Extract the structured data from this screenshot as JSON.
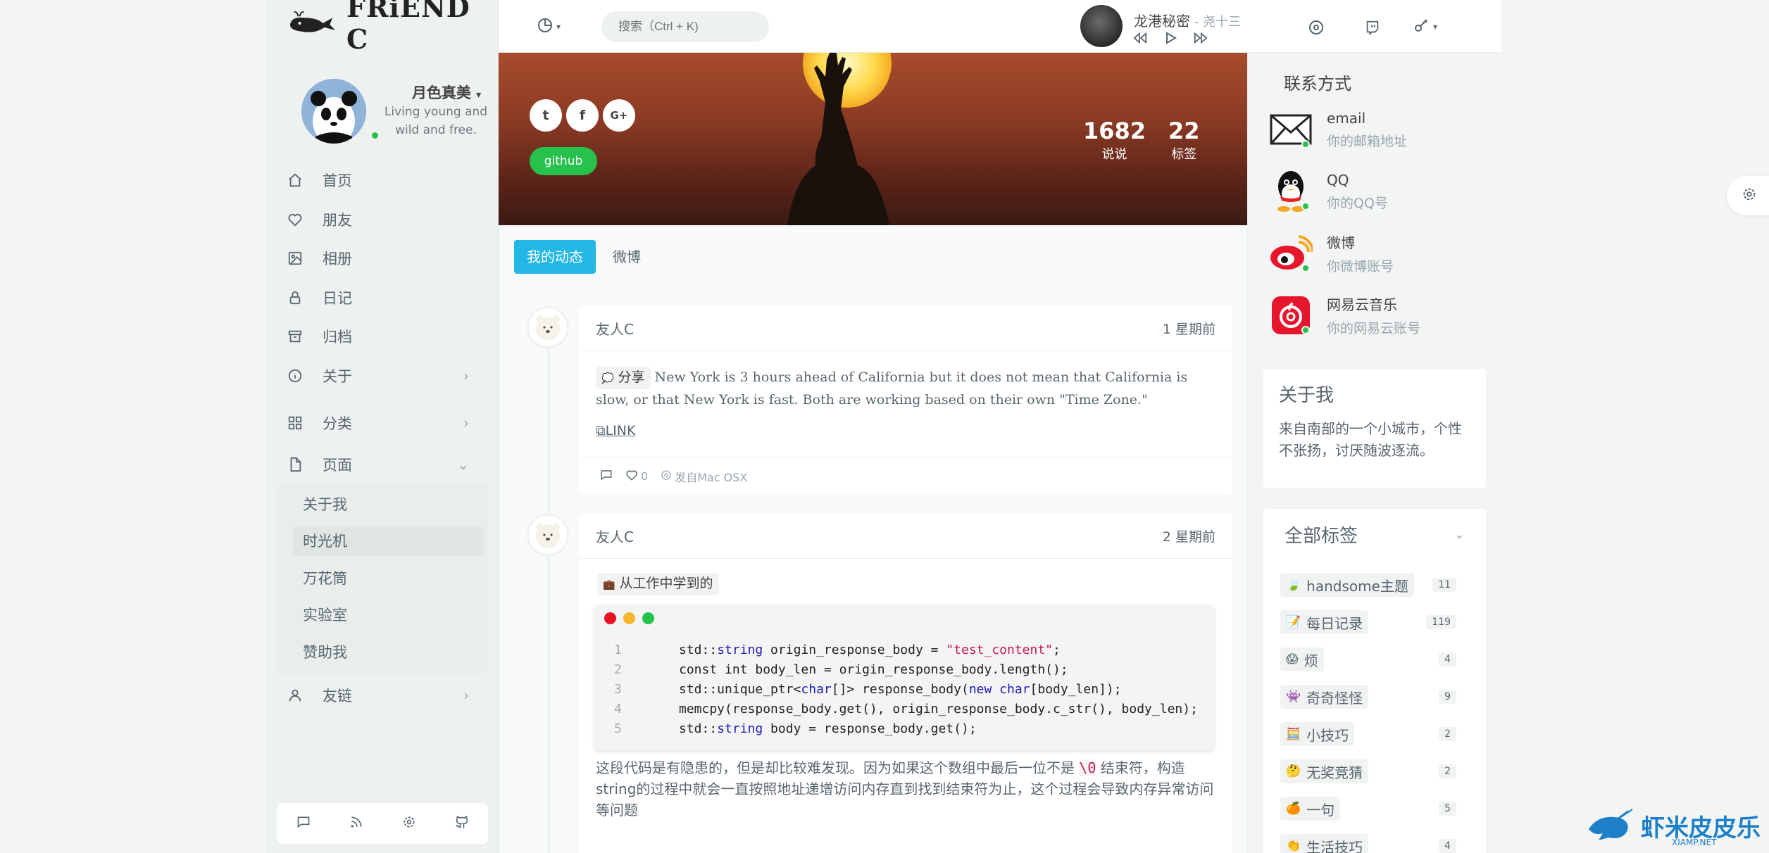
{
  "app": {
    "logo_text": "FRiEND C"
  },
  "profile": {
    "name": "月色真美",
    "subtitle": "Living young and wild and free."
  },
  "sidebar": {
    "items": [
      {
        "label": "首页",
        "icon": "home-icon"
      },
      {
        "label": "朋友",
        "icon": "heart-icon"
      },
      {
        "label": "相册",
        "icon": "image-icon"
      },
      {
        "label": "日记",
        "icon": "lock-icon"
      },
      {
        "label": "归档",
        "icon": "archive-icon"
      },
      {
        "label": "关于",
        "icon": "info-icon",
        "arrow": "›"
      },
      {
        "label": "分类",
        "icon": "grid-icon",
        "arrow": "›"
      },
      {
        "label": "页面",
        "icon": "file-icon",
        "arrow": "⌄"
      }
    ],
    "sub_items": [
      "关于我",
      "时光机",
      "万花筒",
      "实验室",
      "赞助我"
    ],
    "active_sub": "时光机",
    "friends": {
      "label": "友链",
      "icon": "user-icon",
      "arrow": "›"
    },
    "footer_icons": [
      "comment-icon",
      "rss-icon",
      "settings-icon",
      "github-icon"
    ]
  },
  "header": {
    "search_placeholder": "搜索（Ctrl + K)",
    "music": {
      "title": "龙港秘密",
      "artist": " - 尧十三"
    }
  },
  "banner": {
    "github_label": "github",
    "stats": [
      {
        "value": "1682",
        "label": "说说"
      },
      {
        "value": "22",
        "label": "标签"
      }
    ],
    "social": [
      "twitter-icon",
      "facebook-icon",
      "google-plus-icon"
    ],
    "social_glyphs": [
      "t",
      "f",
      "G+"
    ]
  },
  "tabs": [
    {
      "label": "我的动态",
      "active": true
    },
    {
      "label": "微博",
      "active": false
    }
  ],
  "posts": [
    {
      "author": "友人C",
      "time": "1 星期前",
      "tag": "分享",
      "text": "New York is 3 hours ahead of California but it does not mean that California is slow, or that New York is fast. Both are working based on their own \"Time Zone.\"",
      "link": "LINK",
      "likes": "0",
      "device": "发自Mac OSX"
    },
    {
      "author": "友人C",
      "time": "2 星期前",
      "tag": "从工作中学到的",
      "code_lines": [
        {
          "no": "1",
          "parts": [
            [
              "",
              "std::"
            ],
            [
              "kw",
              "string"
            ],
            [
              "",
              " origin_response_body = "
            ],
            [
              "st",
              "\"test_content\""
            ],
            [
              "",
              ";"
            ]
          ]
        },
        {
          "no": "2",
          "parts": [
            [
              "",
              "const int body_len = origin_response_body.length();"
            ]
          ]
        },
        {
          "no": "3",
          "parts": [
            [
              "",
              "std::unique_ptr<"
            ],
            [
              "kw",
              "char"
            ],
            [
              "",
              "[]> response_body("
            ],
            [
              "kw",
              "new char"
            ],
            [
              "",
              "[body_len]);"
            ]
          ]
        },
        {
          "no": "4",
          "parts": [
            [
              "",
              "memcpy(response_body.get(), origin_response_body.c_str(), body_len);"
            ]
          ]
        },
        {
          "no": "5",
          "parts": [
            [
              "",
              "std::"
            ],
            [
              "kw",
              "string"
            ],
            [
              "",
              " body = response_body.get();"
            ]
          ]
        }
      ],
      "text_before": "这段代码是有隐患的，但是却比较难发现。因为如果这个数组中最后一位不是 ",
      "text_code": "\\0",
      "text_after": " 结束符，构造string的过程中就会一直按照地址递增访问内存直到找到结束符为止，这个过程会导致内存异常访问等问题"
    }
  ],
  "contact": {
    "title": "联系方式",
    "items": [
      {
        "name": "email",
        "desc": "你的邮箱地址",
        "icon": "email-icon"
      },
      {
        "name": "QQ",
        "desc": "你的QQ号",
        "icon": "qq-icon"
      },
      {
        "name": "微博",
        "desc": "你微博账号",
        "icon": "weibo-icon"
      },
      {
        "name": "网易云音乐",
        "desc": "你的网易云账号",
        "icon": "netease-music-icon"
      }
    ]
  },
  "about": {
    "title": "关于我",
    "text": "来自南部的一个小城市，个性不张扬，讨厌随波逐流。"
  },
  "tags_panel": {
    "title": "全部标签",
    "tags": [
      {
        "emoji": "🍃",
        "name": "handsome主题",
        "count": "11"
      },
      {
        "emoji": "📝",
        "name": "每日记录",
        "count": "119"
      },
      {
        "emoji": "😱",
        "name": "烦",
        "count": "4"
      },
      {
        "emoji": "👾",
        "name": "奇奇怪怪",
        "count": "9"
      },
      {
        "emoji": "🧮",
        "name": "小技巧",
        "count": "2"
      },
      {
        "emoji": "🤔",
        "name": "无奖竞猜",
        "count": "2"
      },
      {
        "emoji": "🍊",
        "name": "一句",
        "count": "5"
      },
      {
        "emoji": "👏",
        "name": "生活技巧",
        "count": "4"
      }
    ]
  },
  "watermark": {
    "text": "虾米皮皮乐",
    "sub": "XIAMP.NET"
  },
  "colors": {
    "accent": "#23b7e5",
    "green": "#27c24c",
    "sidebar_bg": "#edf1f0"
  }
}
